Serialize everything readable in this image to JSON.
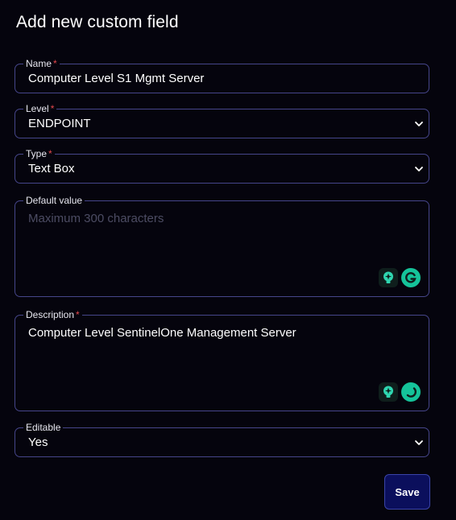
{
  "dialog": {
    "title": "Add new custom field"
  },
  "fields": {
    "name": {
      "label": "Name",
      "required_mark": "*",
      "value": "Computer Level S1 Mgmt Server"
    },
    "level": {
      "label": "Level",
      "required_mark": "*",
      "value": "ENDPOINT"
    },
    "type": {
      "label": "Type",
      "required_mark": "*",
      "value": "Text Box"
    },
    "default_value": {
      "label": "Default value",
      "placeholder": "Maximum 300 characters",
      "value": ""
    },
    "description": {
      "label": "Description",
      "required_mark": "*",
      "value": "Computer Level SentinelOne Management Server"
    },
    "editable": {
      "label": "Editable",
      "value": "Yes"
    }
  },
  "actions": {
    "save_label": "Save"
  },
  "icons": {
    "chevron": "chevron-down-icon",
    "ai_assist": "sparkle-bulb-icon",
    "grammarly": "grammarly-icon"
  },
  "colors": {
    "background": "#05040d",
    "border": "#46468a",
    "required": "#e5484d",
    "accent": "#15c39a",
    "save_button": "#0b0f5c"
  }
}
